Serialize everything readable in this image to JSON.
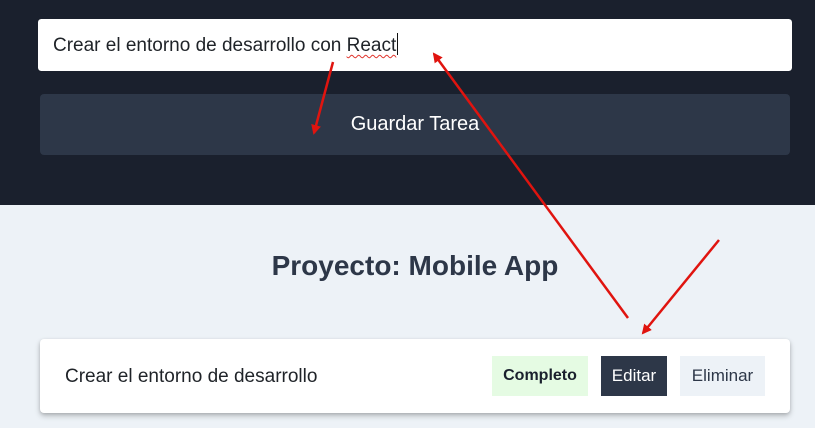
{
  "form": {
    "input_value": "Crear el entorno de desarrollo con ",
    "input_value_misspelled": "React",
    "submit_label": "Guardar Tarea"
  },
  "project": {
    "title": "Proyecto: Mobile App"
  },
  "tasks": [
    {
      "name": "Crear el entorno de desarrollo",
      "status_label": "Completo",
      "edit_label": "Editar",
      "delete_label": "Eliminar"
    }
  ],
  "colors": {
    "dark_bg": "#1a202d",
    "button_bg": "#2d3748",
    "page_bg": "#edf2f7",
    "complete_badge_bg": "#e5fbe3",
    "annotation_arrow": "#e0140f"
  }
}
